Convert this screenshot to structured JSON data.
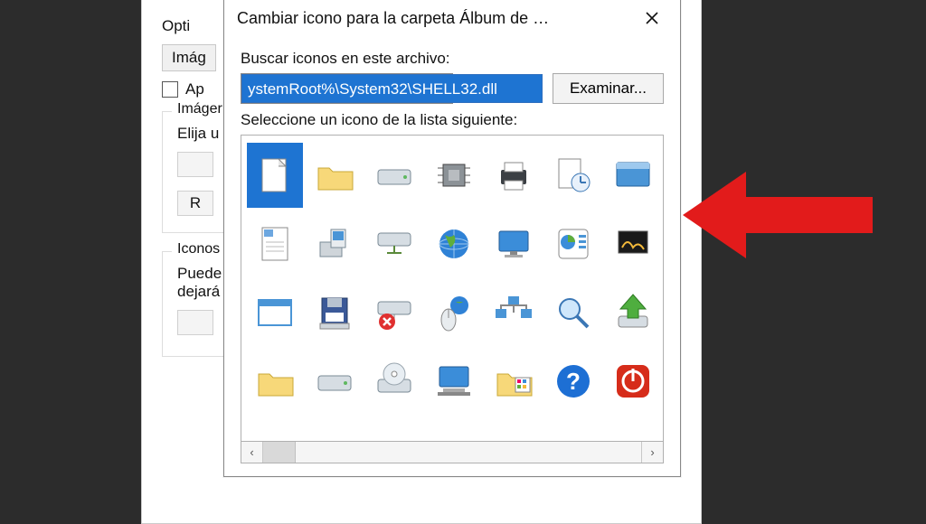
{
  "parent": {
    "optimize_label": "Opti",
    "images_btn": "Imág",
    "apply_checkbox_label": "Ap",
    "section_images": "Imáger",
    "elija_label": "Elija u",
    "r_btn": "R",
    "section_icons": "Iconos",
    "puede_line1": "Puede",
    "puede_line2": "dejará"
  },
  "dialog": {
    "title": "Cambiar icono para la carpeta Álbum de …",
    "search_label": "Buscar iconos en este archivo:",
    "path_value": "ystemRoot%\\System32\\SHELL32.dll",
    "browse": "Examinar...",
    "select_label": "Seleccione un icono de la lista siguiente:"
  },
  "icons": [
    {
      "name": "file-icon",
      "selected": true,
      "svg": "file"
    },
    {
      "name": "folder-icon",
      "selected": false,
      "svg": "folder"
    },
    {
      "name": "drive-icon",
      "selected": false,
      "svg": "drive"
    },
    {
      "name": "chip-icon",
      "selected": false,
      "svg": "chip"
    },
    {
      "name": "printer-icon",
      "selected": false,
      "svg": "printer"
    },
    {
      "name": "recent-file-icon",
      "selected": false,
      "svg": "recent"
    },
    {
      "name": "window-icon",
      "selected": false,
      "svg": "window"
    },
    {
      "name": "document-icon",
      "selected": false,
      "svg": "doc"
    },
    {
      "name": "setup-icon",
      "selected": false,
      "svg": "setup"
    },
    {
      "name": "netdrive-icon",
      "selected": false,
      "svg": "netdrive"
    },
    {
      "name": "globe-icon",
      "selected": false,
      "svg": "globe"
    },
    {
      "name": "monitor-icon",
      "selected": false,
      "svg": "monitor"
    },
    {
      "name": "chart-icon",
      "selected": false,
      "svg": "chart"
    },
    {
      "name": "screensaver-icon",
      "selected": false,
      "svg": "screensaver"
    },
    {
      "name": "app-window-icon",
      "selected": false,
      "svg": "appwin"
    },
    {
      "name": "floppy-icon",
      "selected": false,
      "svg": "floppy"
    },
    {
      "name": "netdrive-x-icon",
      "selected": false,
      "svg": "netdrivex"
    },
    {
      "name": "mouse-globe-icon",
      "selected": false,
      "svg": "mouseglobe"
    },
    {
      "name": "network-icon",
      "selected": false,
      "svg": "network"
    },
    {
      "name": "search-icon",
      "selected": false,
      "svg": "search"
    },
    {
      "name": "arrow-up-icon",
      "selected": false,
      "svg": "arrowup"
    },
    {
      "name": "folder2-icon",
      "selected": false,
      "svg": "folder"
    },
    {
      "name": "drive2-icon",
      "selected": false,
      "svg": "drive"
    },
    {
      "name": "cd-drive-icon",
      "selected": false,
      "svg": "cddrive"
    },
    {
      "name": "computer-icon",
      "selected": false,
      "svg": "computer"
    },
    {
      "name": "folder-apps-icon",
      "selected": false,
      "svg": "folderapps"
    },
    {
      "name": "help-icon",
      "selected": false,
      "svg": "help"
    },
    {
      "name": "power-icon",
      "selected": false,
      "svg": "power"
    }
  ],
  "scroll": {
    "left_arrow": "‹",
    "right_arrow": "›"
  }
}
